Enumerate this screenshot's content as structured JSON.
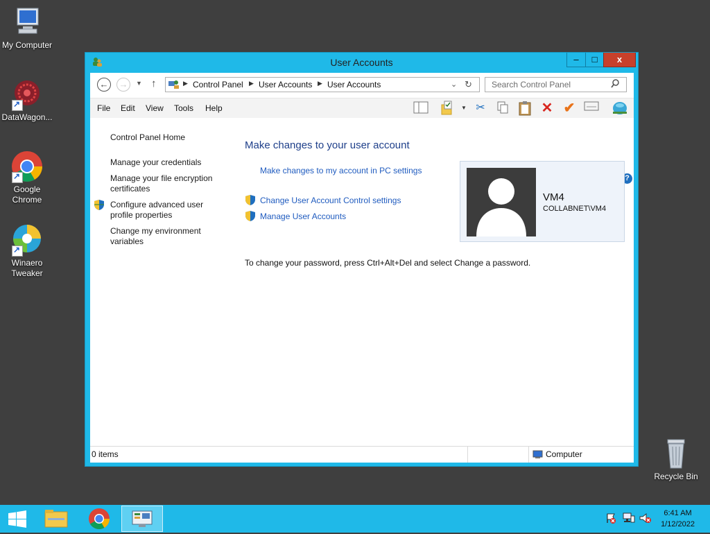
{
  "desktop": {
    "icons": [
      {
        "label": "My Computer"
      },
      {
        "label": "DataWagon..."
      },
      {
        "label": "Google Chrome"
      },
      {
        "label": "Winaero Tweaker"
      },
      {
        "label": "Recycle Bin"
      }
    ]
  },
  "window": {
    "title": "User Accounts",
    "buttons": {
      "minimize": "–",
      "maximize": "□",
      "close": "x"
    }
  },
  "navigation": {
    "breadcrumbs": [
      "Control Panel",
      "User Accounts",
      "User Accounts"
    ],
    "search_placeholder": "Search Control Panel"
  },
  "menu": {
    "items": [
      "File",
      "Edit",
      "View",
      "Tools",
      "Help"
    ]
  },
  "sidebar": {
    "home": "Control Panel Home",
    "links": [
      "Manage your credentials",
      "Manage your file encryption certificates",
      "Configure advanced user profile properties",
      "Change my environment variables"
    ]
  },
  "main": {
    "heading": "Make changes to your user account",
    "pc_settings_link": "Make changes to my account in PC settings",
    "uac_link": "Change User Account Control settings",
    "manage_link": "Manage User Accounts",
    "password_note": "To change your password, press Ctrl+Alt+Del and select Change a password.",
    "user": {
      "name": "VM4",
      "domain": "COLLABNET\\VM4"
    }
  },
  "statusbar": {
    "items": "0 items",
    "zone": "Computer"
  },
  "taskbar": {
    "time": "6:41 AM",
    "date": "1/12/2022"
  },
  "colors": {
    "accent": "#1fb9e8",
    "desktop": "#3f3f3f",
    "link": "#1f5bbf",
    "heading": "#1e3f8a",
    "close": "#c7402b"
  }
}
